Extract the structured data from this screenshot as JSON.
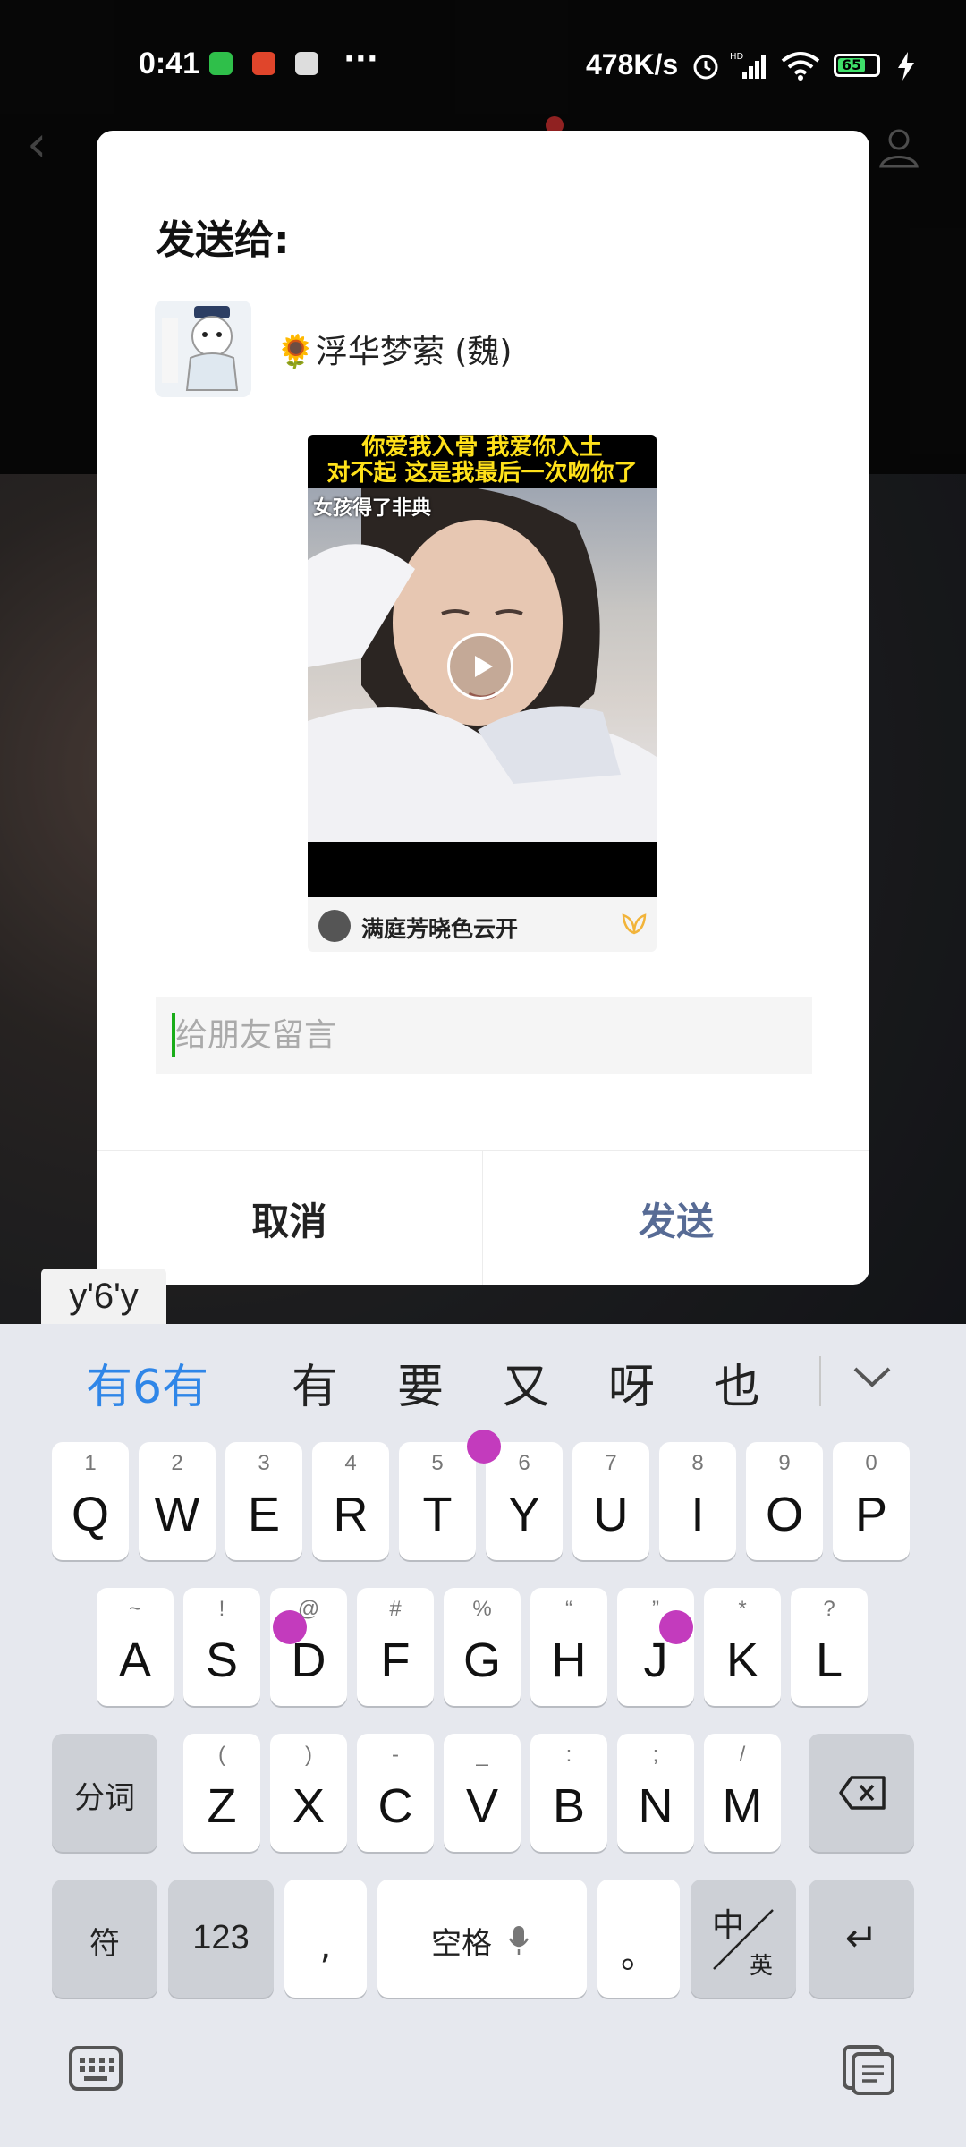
{
  "status_bar": {
    "time": "0:41",
    "more": "···",
    "net_speed": "478K/s",
    "battery": "65",
    "hd_label": "HD"
  },
  "dialog": {
    "title": "发送给:",
    "recipient": {
      "name": "🌻浮华梦萦 (魏)"
    },
    "video_card": {
      "caption_line1": "你爱我入骨 我爱你入土",
      "caption_line2": "对不起 这是我最后一次吻你了",
      "caption_line3": "女孩得了非典",
      "author": "满庭芳晓色云开"
    },
    "message_placeholder": "给朋友留言",
    "cancel_label": "取消",
    "send_label": "发送"
  },
  "keyboard": {
    "composing": "y'6'y",
    "candidates": [
      "有6有",
      "有",
      "要",
      "又",
      "呀",
      "也"
    ],
    "row1": [
      {
        "main": "Q",
        "sub": "1"
      },
      {
        "main": "W",
        "sub": "2"
      },
      {
        "main": "E",
        "sub": "3"
      },
      {
        "main": "R",
        "sub": "4"
      },
      {
        "main": "T",
        "sub": "5"
      },
      {
        "main": "Y",
        "sub": "6"
      },
      {
        "main": "U",
        "sub": "7"
      },
      {
        "main": "I",
        "sub": "8"
      },
      {
        "main": "O",
        "sub": "9"
      },
      {
        "main": "P",
        "sub": "0"
      }
    ],
    "row2": [
      {
        "main": "A",
        "sub": "~"
      },
      {
        "main": "S",
        "sub": "!"
      },
      {
        "main": "D",
        "sub": "@"
      },
      {
        "main": "F",
        "sub": "#"
      },
      {
        "main": "G",
        "sub": "%"
      },
      {
        "main": "H",
        "sub": "“"
      },
      {
        "main": "J",
        "sub": "”"
      },
      {
        "main": "K",
        "sub": "*"
      },
      {
        "main": "L",
        "sub": "?"
      }
    ],
    "row3": [
      {
        "main": "Z",
        "sub": "("
      },
      {
        "main": "X",
        "sub": ")"
      },
      {
        "main": "C",
        "sub": "-"
      },
      {
        "main": "V",
        "sub": "_"
      },
      {
        "main": "B",
        "sub": ":"
      },
      {
        "main": "N",
        "sub": ";"
      },
      {
        "main": "M",
        "sub": "/"
      }
    ],
    "fenci_label": "分词",
    "symbol_label": "符",
    "num_label": "123",
    "comma_label": ",",
    "space_label": "空格",
    "period_label": "。",
    "lang_top": "中",
    "lang_bottom": "英",
    "enter_label": "↵"
  }
}
